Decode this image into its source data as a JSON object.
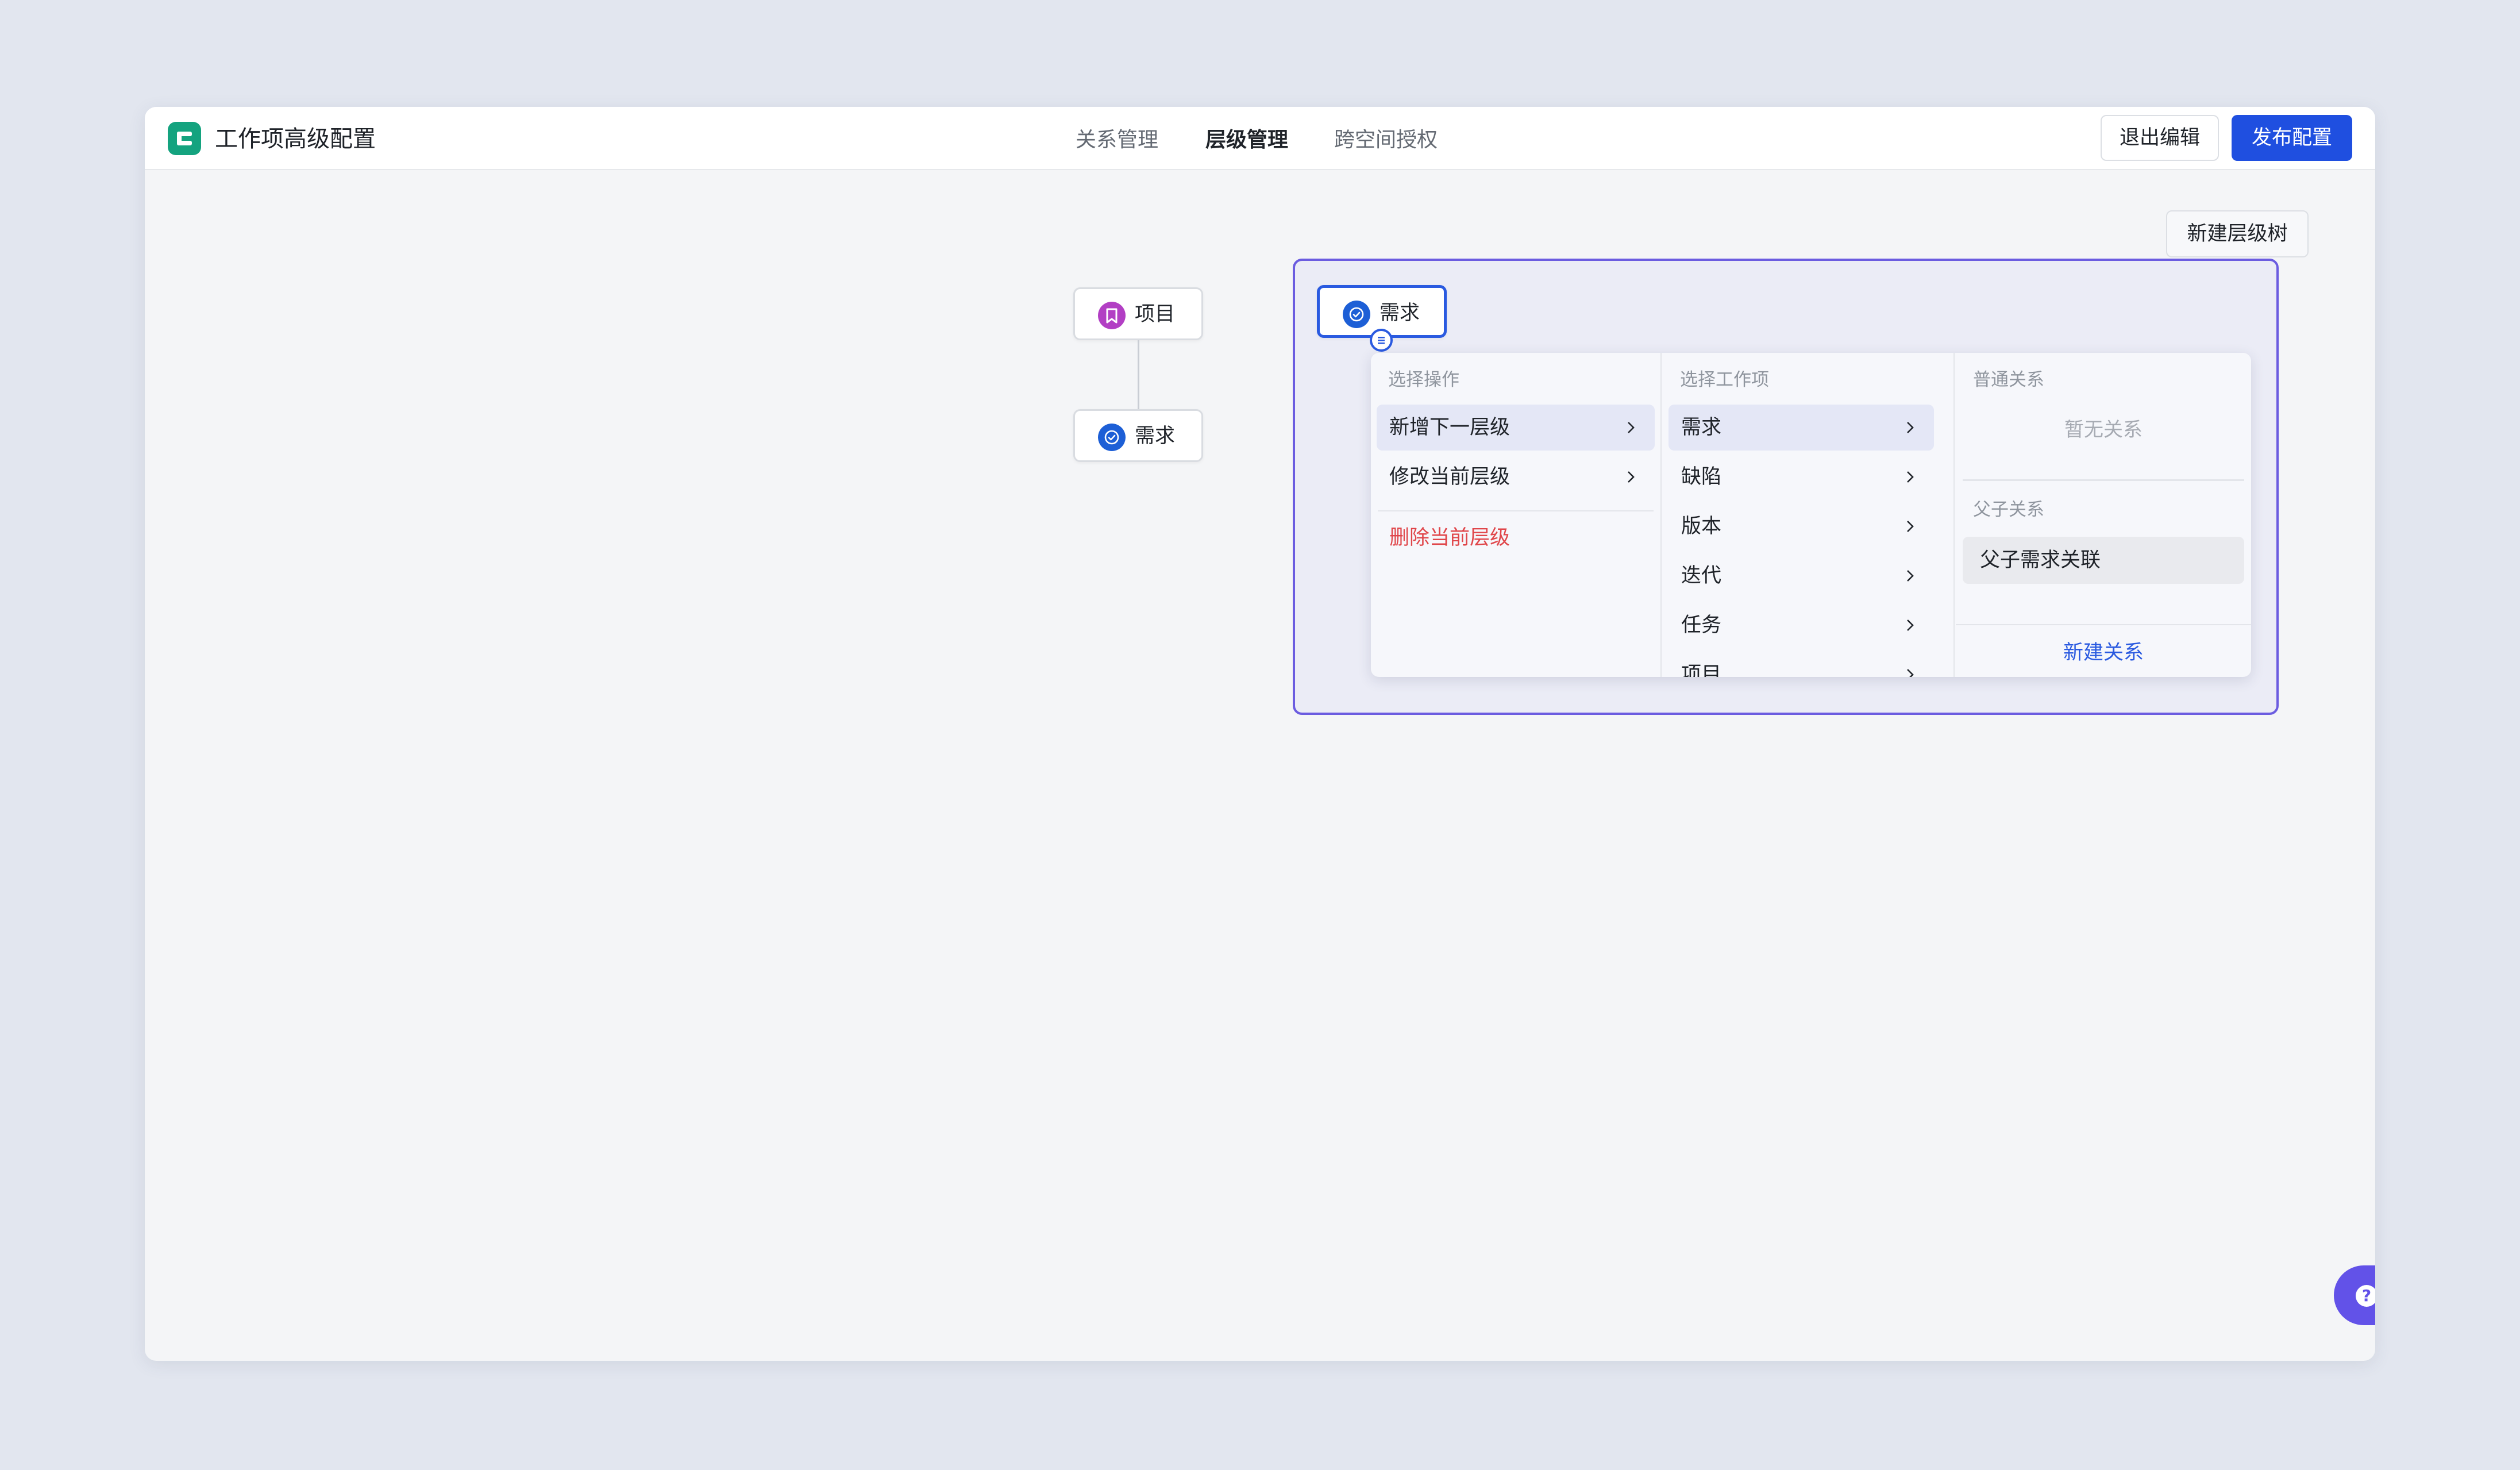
{
  "app": {
    "title": "工作项高级配置",
    "logo_icon": "list-icon",
    "logo_color": "#14a37f"
  },
  "tabs": [
    {
      "label": "关系管理",
      "active": false
    },
    {
      "label": "层级管理",
      "active": true
    },
    {
      "label": "跨空间授权",
      "active": false
    }
  ],
  "actions": {
    "exit_label": "退出编辑",
    "publish_label": "发布配置",
    "publish_color": "#1f4fe0"
  },
  "canvas": {
    "new_tree_label": "新建层级树",
    "tree1": {
      "root": {
        "label": "项目",
        "icon": "bookmark-icon",
        "color": "#b23fc4"
      },
      "child": {
        "label": "需求",
        "icon": "check-circle-icon",
        "color": "#1d5fd6"
      }
    },
    "tree2": {
      "root": {
        "label": "需求",
        "icon": "check-circle-icon",
        "color": "#1d5fd6"
      },
      "border_color": "#6b5ce0"
    }
  },
  "menu": {
    "operations": {
      "header": "选择操作",
      "items": [
        "新增下一层级",
        "修改当前层级",
        "删除当前层级"
      ]
    },
    "workitems": {
      "header": "选择工作项",
      "items": [
        "需求",
        "缺陷",
        "版本",
        "迭代",
        "任务",
        "项目"
      ]
    },
    "relations": {
      "normal_header": "普通关系",
      "normal_empty": "暂无关系",
      "parent_header": "父子关系",
      "parent_items": [
        "父子需求关联"
      ],
      "new_label": "新建关系"
    }
  },
  "help": {
    "label": "?",
    "icon": "help-icon",
    "color": "#6252e8"
  }
}
